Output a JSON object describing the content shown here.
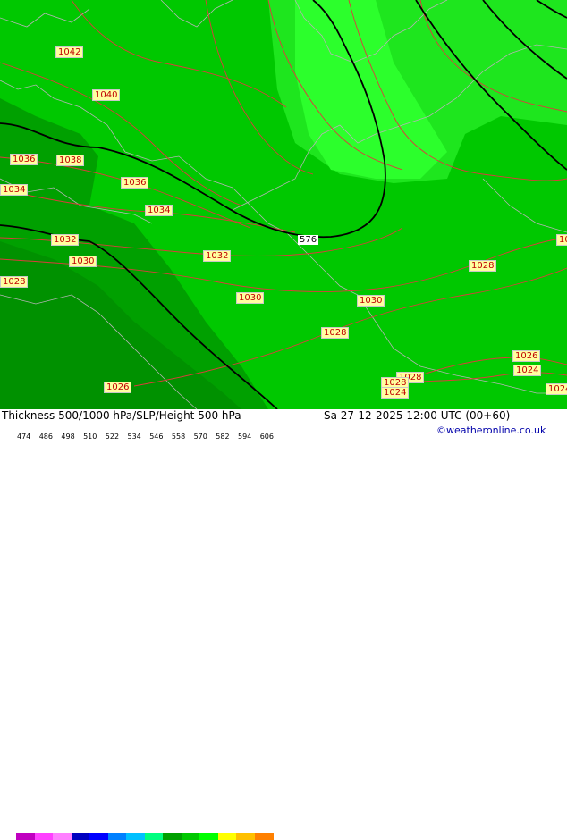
{
  "map": {
    "colors": {
      "background": "#00c800",
      "light_zone": "#1ee61e",
      "lighter_zone": "#2cff2c",
      "dark_zone": "#00a000",
      "darker_zone": "#009100",
      "coast": "#b4b4b4",
      "isobar": "#dc3c3c",
      "height_contour": "#000000"
    },
    "pressure_labels": [
      "1042",
      "1040",
      "1038",
      "1036",
      "1036",
      "1034",
      "1034",
      "1032",
      "1032",
      "1030",
      "1030",
      "1030",
      "1028",
      "1028",
      "1028",
      "1028",
      "1026",
      "1026",
      "1024",
      "1024",
      "1024",
      "1028",
      "1028",
      "1028"
    ],
    "height_label": "576"
  },
  "footer": {
    "title": "Thickness 500/1000 hPa/SLP/Height 500 hPa",
    "datetime": "Sa 27-12-2025 12:00 UTC (00+60)",
    "credit": "©weatheronline.co.uk",
    "legend_ticks": [
      "474",
      "486",
      "498",
      "510",
      "522",
      "534",
      "546",
      "558",
      "570",
      "582",
      "594",
      "606"
    ],
    "legend_colors": [
      "#c000c0",
      "#ff40ff",
      "#ff80ff",
      "#0000c0",
      "#0000ff",
      "#0080ff",
      "#00c0ff",
      "#00ff80",
      "#00a000",
      "#00c800",
      "#00ff00",
      "#ffff00",
      "#ffc000",
      "#ff8000"
    ]
  }
}
